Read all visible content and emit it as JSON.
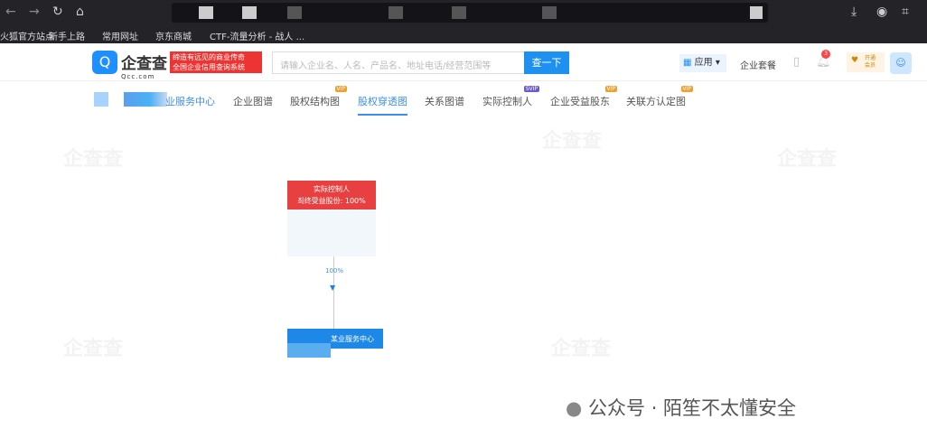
{
  "browser": {
    "bookmarks": [
      "火狐官方站点",
      "新手上路",
      "常用网址",
      "京东商城",
      "CTF-流量分析 - 战人 ..."
    ]
  },
  "header": {
    "logo_text": "企查查",
    "logo_sub": "Qcc.com",
    "slogan_line1": "缔造有远见的商业传奇",
    "slogan_line2": "全国企业信用查询系统",
    "search_placeholder": "请输入企业名、人名、产品名、地址电话/经营范围等",
    "search_button": "查一下",
    "apps": "应用",
    "package": "企业套餐",
    "notification_count": "3",
    "vip_line1": "开通",
    "vip_line2": "会员"
  },
  "tabs": [
    {
      "label": "业服务中心"
    },
    {
      "label": "企业图谱"
    },
    {
      "label": "股权结构图",
      "badge": "VIP"
    },
    {
      "label": "股权穿透图"
    },
    {
      "label": "关系图谱"
    },
    {
      "label": "实际控制人",
      "badge": "SVIP"
    },
    {
      "label": "企业受益股东",
      "badge": "VIP"
    },
    {
      "label": "关联方认定图",
      "badge": "VIP"
    }
  ],
  "graph": {
    "controller_label": "实际控制人",
    "controller_share": "최终受益股份: 100%",
    "edge_label": "100%",
    "company": "某业服务中心"
  },
  "watermark": {
    "text": "公众号 · 陌笙不太懂安全"
  },
  "colors": {
    "accent": "#1e90f0",
    "red": "#e84040"
  }
}
